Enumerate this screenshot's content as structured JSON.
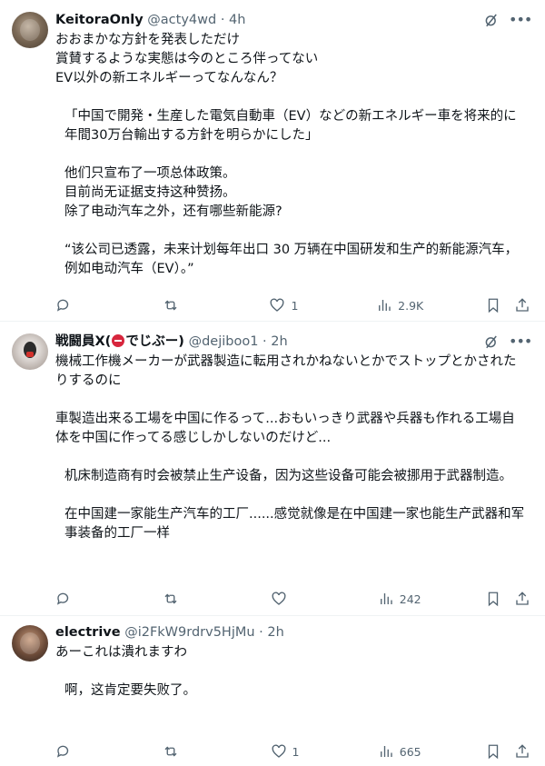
{
  "posts": [
    {
      "name": "KeitoraOnly",
      "handle": "@acty4wd",
      "dot": "·",
      "time": "4h",
      "lines": [
        "おおまかな方針を発表しただけ",
        "賞賛するような実態は今のところ伴ってない",
        "EV以外の新エネルギーってなんなん？",
        "",
        "「中国で開発・生産した電気自動車（EV）などの新エネルギー車を将来的に年間30万台輸出する方針を明らかにした」",
        "",
        "他们只宣布了一项总体政策。",
        "目前尚无证据支持这种赞扬。",
        "除了电动汽车之外，还有哪些新能源?",
        "",
        "“该公司已透露，未来计划每年出口 30 万辆在中国研发和生产的新能源汽车，例如电动汽车（EV）。”"
      ],
      "stats": {
        "replies": "",
        "retweets": "",
        "likes": "1",
        "views": "2.9K"
      }
    },
    {
      "name": "戦闘員X(",
      "name_tail": "でじぶー)",
      "handle": "@dejiboo1",
      "dot": "·",
      "time": "2h",
      "lines": [
        "機械工作機メーカーが武器製造に転用されかねないとかでストップとかされたりするのに",
        "",
        "車製造出来る工場を中国に作るって...おもいっきり武器や兵器も作れる工場自体を中国に作ってる感じしかしないのだけど...",
        "",
        "机床制造商有时会被禁止生产设备，因为这些设备可能会被挪用于武器制造。",
        "",
        "在中国建一家能生产汽车的工厂......感觉就像是在中国建一家也能生产武器和军事装备的工厂一样"
      ],
      "stats": {
        "replies": "",
        "retweets": "",
        "likes": "",
        "views": "242"
      }
    },
    {
      "name": "electrive",
      "handle": "@i2FkW9rdrv5HjMu",
      "dot": "·",
      "time": "2h",
      "lines": [
        "あーこれは潰れますわ",
        "",
        "啊，这肯定要失败了。"
      ],
      "stats": {
        "replies": "",
        "retweets": "",
        "likes": "1",
        "views": "665"
      }
    }
  ],
  "icons": [
    "avatar",
    "grok-icon",
    "more-icon",
    "reply-icon",
    "retweet-icon",
    "like-icon",
    "views-icon",
    "bookmark-icon",
    "share-icon"
  ],
  "colors": {
    "text": "#0f1419",
    "secondary": "#536471",
    "divider": "#eff3f4",
    "badge": "#d7263d"
  }
}
